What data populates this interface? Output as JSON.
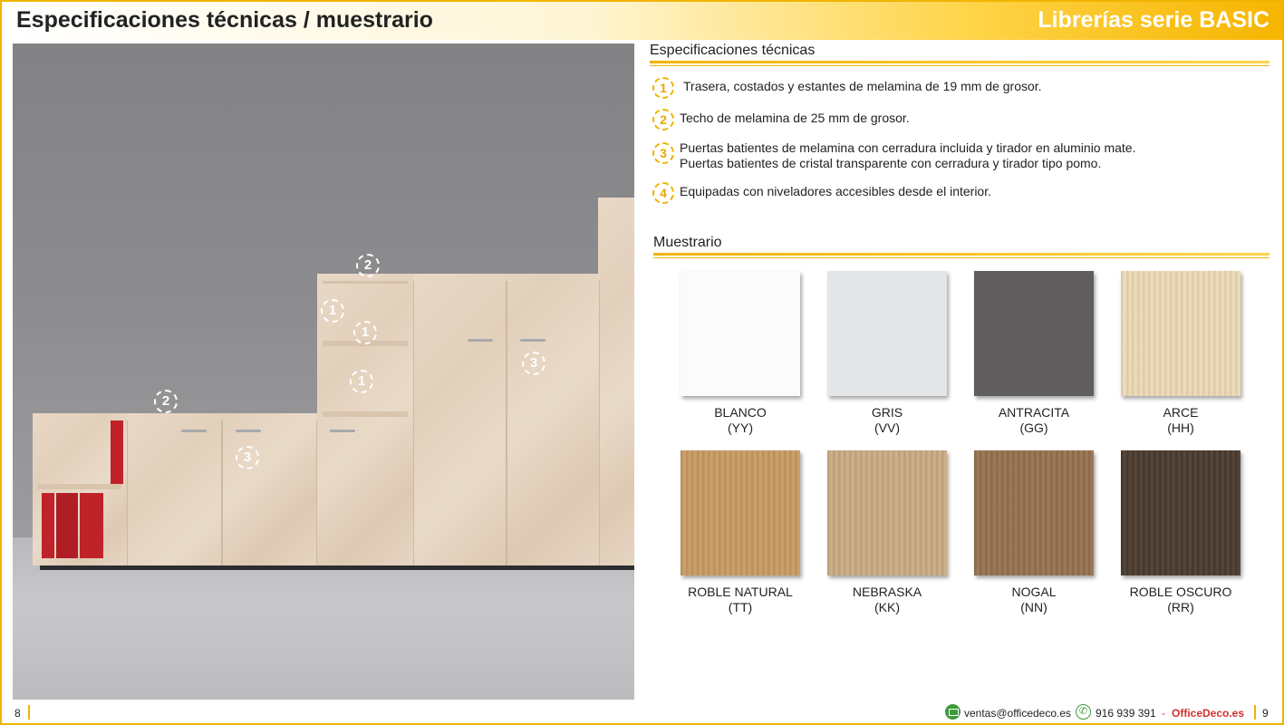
{
  "header": {
    "title": "Especificaciones técnicas / muestrario",
    "series": "Librerías serie BASIC"
  },
  "photo": {
    "markers": [
      "2",
      "1",
      "1",
      "1",
      "2",
      "3",
      "3"
    ]
  },
  "specs": {
    "title": "Especificaciones técnicas",
    "items": [
      {
        "num": "1",
        "lines": [
          "Trasera, costados y estantes de melamina de 19 mm de grosor."
        ]
      },
      {
        "num": "2",
        "lines": [
          "Techo de melamina de 25 mm de grosor."
        ]
      },
      {
        "num": "3",
        "lines": [
          "Puertas batientes de melamina con cerradura incluida y tirador en aluminio mate.",
          "Puertas batientes de cristal transparente con cerradura y tirador tipo pomo."
        ]
      },
      {
        "num": "4",
        "lines": [
          "Equipadas con niveladores accesibles desde el interior."
        ]
      }
    ]
  },
  "swatches": {
    "title": "Muestrario",
    "items": [
      {
        "name": "BLANCO",
        "code": "(YY)",
        "color": "#fbfbfb"
      },
      {
        "name": "GRIS",
        "code": "(VV)",
        "color": "#e3e5e7"
      },
      {
        "name": "ANTRACITA",
        "code": "(GG)",
        "color": "#5f5d5d"
      },
      {
        "name": "ARCE",
        "code": "(HH)",
        "color": "#ecd8b4"
      },
      {
        "name": "ROBLE NATURAL",
        "code": "(TT)",
        "color": "#c89a64"
      },
      {
        "name": "NEBRASKA",
        "code": "(KK)",
        "color": "#c9ab83"
      },
      {
        "name": "NOGAL",
        "code": "(NN)",
        "color": "#95724f"
      },
      {
        "name": "ROBLE OSCURO",
        "code": "(RR)",
        "color": "#4a3b2e"
      }
    ]
  },
  "footer": {
    "page_left": "8",
    "page_right": "9",
    "email": "ventas@officedeco.es",
    "phone": "916 939 391",
    "dash": "-",
    "brand": "OfficeDeco.es"
  }
}
